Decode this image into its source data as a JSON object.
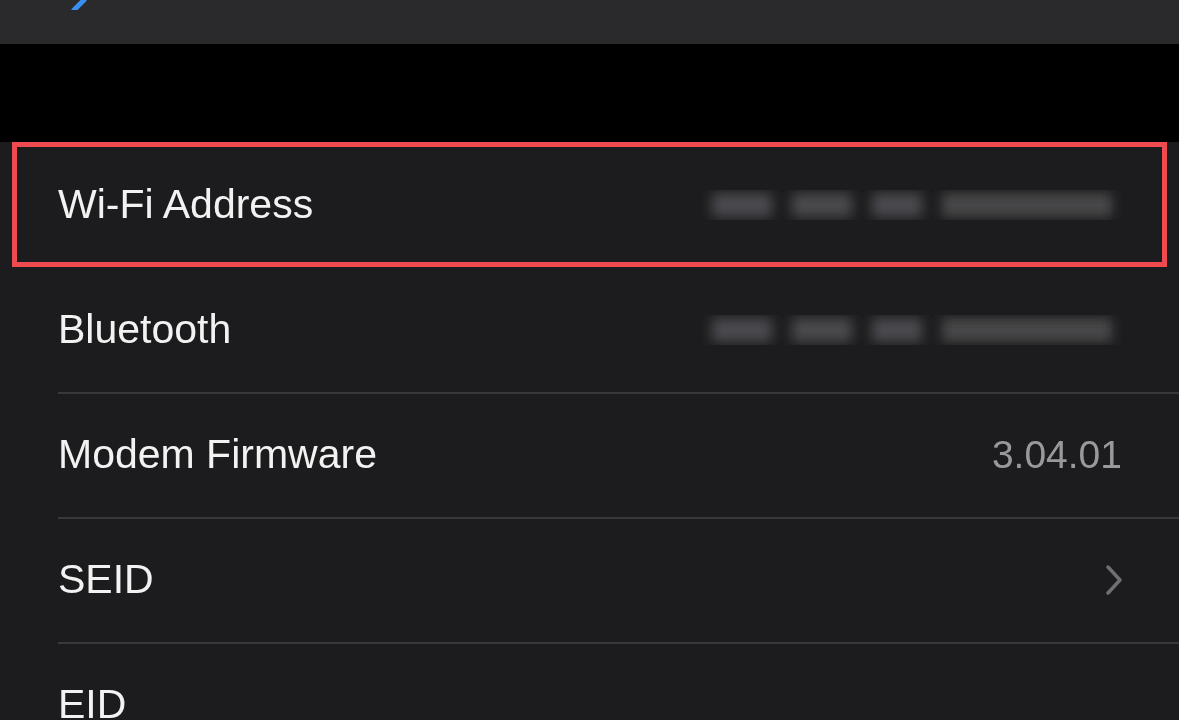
{
  "rows": [
    {
      "label": "Wi-Fi Address",
      "kind": "blurred",
      "highlighted": true
    },
    {
      "label": "Bluetooth",
      "kind": "blurred",
      "highlighted": false
    },
    {
      "label": "Modem Firmware",
      "kind": "text",
      "value": "3.04.01",
      "highlighted": false
    },
    {
      "label": "SEID",
      "kind": "chevron",
      "highlighted": false
    },
    {
      "label": "EID",
      "kind": "none",
      "highlighted": false
    }
  ]
}
